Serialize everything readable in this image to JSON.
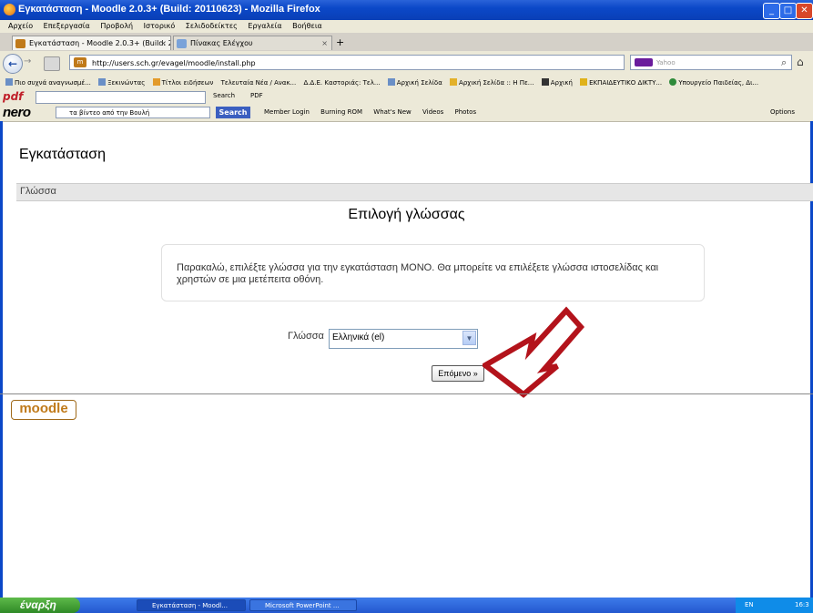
{
  "window": {
    "title": "Εγκατάσταση - Moodle 2.0.3+ (Build: 20110623) - Mozilla Firefox",
    "controls": [
      "_",
      "□",
      "✕"
    ]
  },
  "menu": [
    "Αρχείο",
    "Επεξεργασία",
    "Προβολή",
    "Ιστορικό",
    "Σελιδοδείκτες",
    "Εργαλεία",
    "Βοήθεια"
  ],
  "tabs": [
    {
      "label": "Εγκατάσταση - Moodle 2.0.3+ (Build: 20...",
      "close": "×"
    },
    {
      "label": "Πίνακας Ελέγχου",
      "close": "×"
    }
  ],
  "new_tab": "+",
  "nav": {
    "back": "←",
    "forward": "→",
    "url": "http://users.sch.gr/evagel/moodle/install.php",
    "search_placeholder": "Yahoo",
    "home": "⌂"
  },
  "bookmarks": [
    "Πιο συχνά αναγνωσμέ...",
    "Ξεκινώντας",
    "Τίτλοι ειδήσεων",
    "Τελευταία Νέα / Ανακ...",
    "Δ.Δ.Ε. Καστοριάς: Τελ...",
    "Αρχική Σελίδα",
    "Αρχική Σελίδα :: Η Πε...",
    "Αρχική",
    "ΕΚΠΑΙΔΕΥΤΙΚΟ ΔΙΚΤΥ...",
    "Υπουργείο Παιδείας, Δι..."
  ],
  "pdf_toolbar": {
    "logo": "pdf",
    "search_label": "Search",
    "pdf_label": "PDF"
  },
  "nero_toolbar": {
    "logo": "nero",
    "search_value": "τα βίντεο από την Βουλή",
    "search_button": "Search",
    "items": [
      "Member Login",
      "Burning ROM",
      "What's New",
      "Videos",
      "Photos"
    ],
    "options": "Options"
  },
  "page": {
    "heading": "Εγκατάσταση",
    "section_label": "Γλώσσα",
    "title": "Επιλογή γλώσσας",
    "info": "Παρακαλώ, επιλέξτε γλώσσα για την εγκατάσταση ΜΟΝΟ. Θα μπορείτε να επιλέξετε γλώσσα ιστοσελίδας και χρηστών σε μια μετέπειτα οθόνη.",
    "language_label": "Γλώσσα",
    "language_selected": "Ελληνικά (el)",
    "next_button": "Επόμενο »",
    "logo": "moodle",
    "annotation_arrow_color": "#b3131b"
  },
  "taskbar": {
    "start": "έναρξη",
    "tasks": [
      "Εγκατάσταση - Moodl...",
      "Microsoft PowerPoint ..."
    ],
    "lang": "EN",
    "clock": "16:3"
  },
  "colors": {
    "titlebar": "#0b48c8",
    "chrome": "#ece9d8",
    "taskbar": "#2458cf",
    "moodle_orange": "#c07a1a"
  }
}
